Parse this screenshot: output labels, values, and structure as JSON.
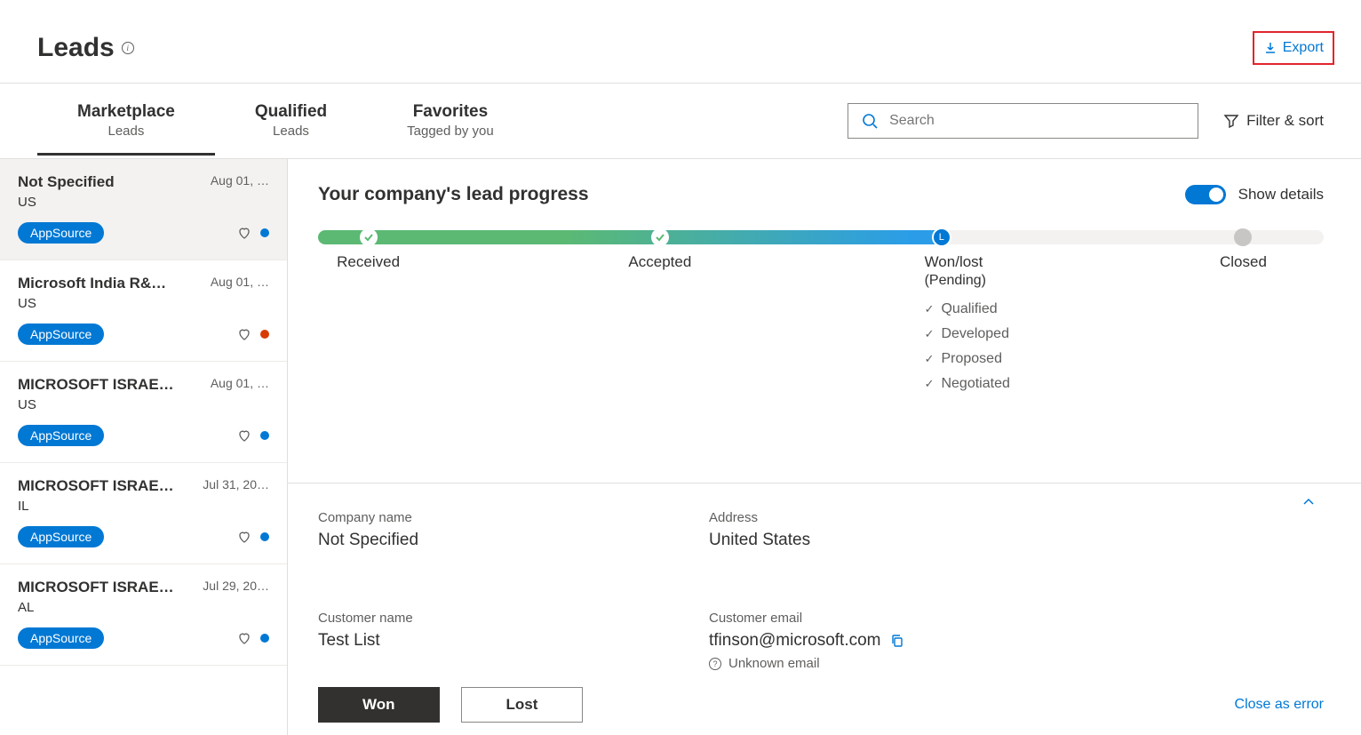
{
  "header": {
    "title": "Leads",
    "export_label": "Export"
  },
  "toolbar": {
    "tabs": [
      {
        "label": "Marketplace",
        "sub": "Leads"
      },
      {
        "label": "Qualified",
        "sub": "Leads"
      },
      {
        "label": "Favorites",
        "sub": "Tagged by you"
      }
    ],
    "search_placeholder": "Search",
    "filter_label": "Filter & sort"
  },
  "leads": [
    {
      "name": "Not Specified",
      "date": "Aug 01, …",
      "loc": "US",
      "chip": "AppSource",
      "dot": "blue"
    },
    {
      "name": "Microsoft India R&…",
      "date": "Aug 01, …",
      "loc": "US",
      "chip": "AppSource",
      "dot": "orange"
    },
    {
      "name": "MICROSOFT ISRAE…",
      "date": "Aug 01, …",
      "loc": "US",
      "chip": "AppSource",
      "dot": "blue"
    },
    {
      "name": "MICROSOFT ISRAE…",
      "date": "Jul 31, 20…",
      "loc": "IL",
      "chip": "AppSource",
      "dot": "blue"
    },
    {
      "name": "MICROSOFT ISRAE…",
      "date": "Jul 29, 20…",
      "loc": "AL",
      "chip": "AppSource",
      "dot": "blue"
    }
  ],
  "detail": {
    "title": "Your company's lead progress",
    "toggle_label": "Show details",
    "stages": {
      "received": "Received",
      "accepted": "Accepted",
      "wonlost": "Won/lost",
      "wonlost_sub": "(Pending)",
      "closed": "Closed",
      "subitems": [
        "Qualified",
        "Developed",
        "Proposed",
        "Negotiated"
      ]
    },
    "labels": {
      "company": "Company name",
      "address": "Address",
      "customer_name": "Customer name",
      "customer_email": "Customer email",
      "unknown_email": "Unknown email"
    },
    "values": {
      "company": "Not Specified",
      "address": "United States",
      "customer_name": "Test List",
      "customer_email": "tfinson@microsoft.com"
    }
  },
  "footer": {
    "won": "Won",
    "lost": "Lost",
    "close_error": "Close as error"
  }
}
